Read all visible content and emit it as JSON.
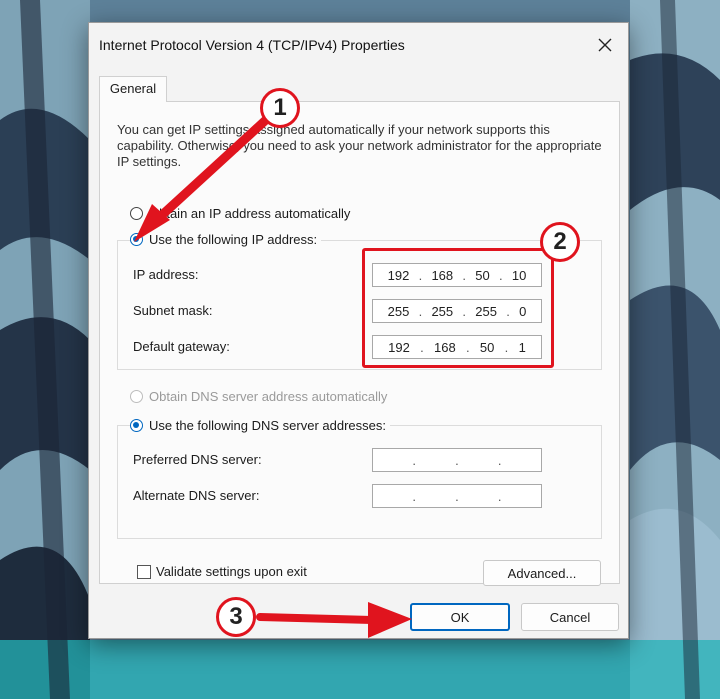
{
  "window": {
    "title": "Internet Protocol Version 4 (TCP/IPv4) Properties",
    "close_glyph": "✕"
  },
  "tabs": [
    {
      "label": "General"
    }
  ],
  "info_text": "You can get IP settings assigned automatically if your network supports this capability. Otherwise, you need to ask your network administrator for the appropriate IP settings.",
  "ip_section": {
    "obtain_auto_label": "Obtain an IP address automatically",
    "use_following_label": "Use the following IP address:",
    "fields": [
      {
        "label": "IP address:",
        "octets": [
          "192",
          "168",
          "50",
          "10"
        ]
      },
      {
        "label": "Subnet mask:",
        "octets": [
          "255",
          "255",
          "255",
          "0"
        ]
      },
      {
        "label": "Default gateway:",
        "octets": [
          "192",
          "168",
          "50",
          "1"
        ]
      }
    ]
  },
  "dns_section": {
    "obtain_auto_label": "Obtain DNS server address automatically",
    "use_following_label": "Use the following DNS server addresses:",
    "fields": [
      {
        "label": "Preferred DNS server:",
        "octets": [
          "",
          "",
          "",
          ""
        ]
      },
      {
        "label": "Alternate DNS server:",
        "octets": [
          "",
          "",
          "",
          ""
        ]
      }
    ]
  },
  "validate_label": "Validate settings upon exit",
  "buttons": {
    "advanced": "Advanced...",
    "ok": "OK",
    "cancel": "Cancel"
  },
  "annotations": {
    "step1": "1",
    "step2": "2",
    "step3": "3",
    "color": "#e0141e"
  },
  "icons": [
    "close-icon",
    "radio-icon",
    "checkbox-icon"
  ]
}
